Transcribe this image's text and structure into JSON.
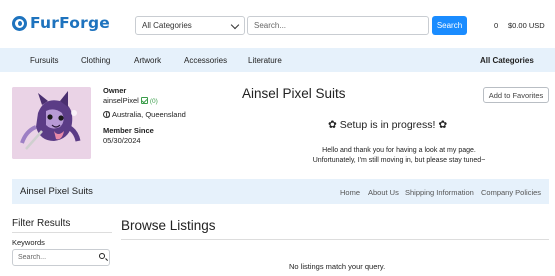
{
  "header": {
    "logo_text": "FurForge",
    "category_select": "All Categories",
    "search_placeholder": "Search...",
    "search_button": "Search",
    "cart_count": "0",
    "cart_total": "$0.00 USD"
  },
  "nav": {
    "items": [
      "Fursuits",
      "Clothing",
      "Artwork",
      "Accessories",
      "Literature"
    ],
    "all_categories": "All Categories"
  },
  "profile": {
    "owner_label": "Owner",
    "owner_name": "ainselPixel",
    "verify_count": "(0)",
    "location": "Australia, Queensland",
    "member_since_label": "Member Since",
    "member_since": "05/30/2024"
  },
  "shop": {
    "title": "Ainsel Pixel Suits",
    "favorite_button": "Add to Favorites",
    "setup_message": "✿ Setup is in progress! ✿",
    "welcome_line1": "Hello and thank you for having a look at my page.",
    "welcome_line2": "Unfortunately, I'm still moving in, but please stay tuned~"
  },
  "store_bar": {
    "name": "Ainsel Pixel Suits",
    "links": [
      "Home",
      "About Us",
      "Shipping Information",
      "Company Policies"
    ]
  },
  "filters": {
    "title": "Filter Results",
    "keywords_label": "Keywords",
    "keywords_placeholder": "Search..."
  },
  "listings": {
    "title": "Browse Listings",
    "empty_message": "No listings match your query."
  },
  "colors": {
    "brand": "#1e73be",
    "search_button": "#1a8cff",
    "nav_background": "#e6f1fb",
    "verified": "#3a9d4a"
  }
}
